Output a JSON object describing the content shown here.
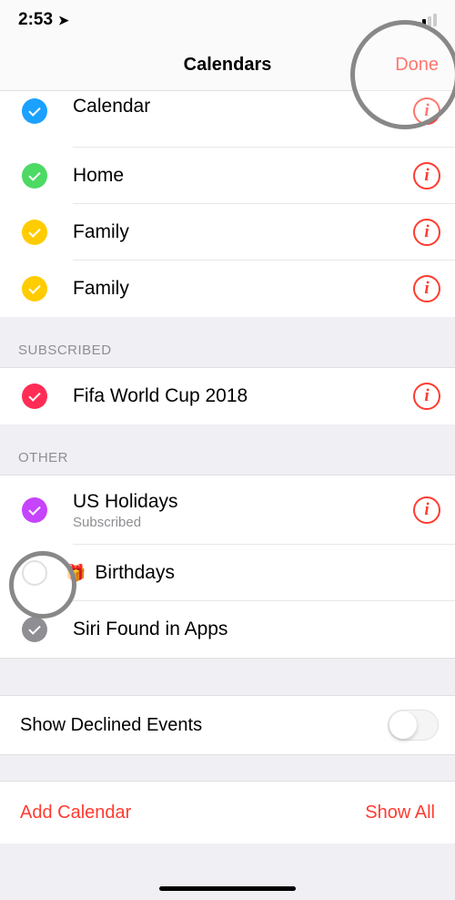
{
  "statusBar": {
    "time": "2:53"
  },
  "header": {
    "title": "Calendars",
    "done": "Done"
  },
  "partialRow": {
    "label": "Calendar",
    "color": "#1ba1ff"
  },
  "mainCalendars": [
    {
      "label": "Home",
      "color": "#4cd964"
    },
    {
      "label": "Family",
      "color": "#ffcc00"
    },
    {
      "label": "Family",
      "color": "#ffcc00"
    }
  ],
  "sections": {
    "subscribed": {
      "header": "SUBSCRIBED",
      "items": [
        {
          "label": "Fifa World Cup 2018",
          "color": "#ff2d55"
        }
      ]
    },
    "other": {
      "header": "OTHER",
      "items": [
        {
          "label": "US Holidays",
          "sublabel": "Subscribed",
          "color": "#c644fc",
          "info": true
        },
        {
          "label": "Birthdays",
          "empty": true,
          "icon": "🎁"
        },
        {
          "label": "Siri Found in Apps",
          "color": "#8e8e93"
        }
      ]
    }
  },
  "options": {
    "declined": "Show Declined Events"
  },
  "footer": {
    "addCalendar": "Add Calendar",
    "showAll": "Show All"
  }
}
